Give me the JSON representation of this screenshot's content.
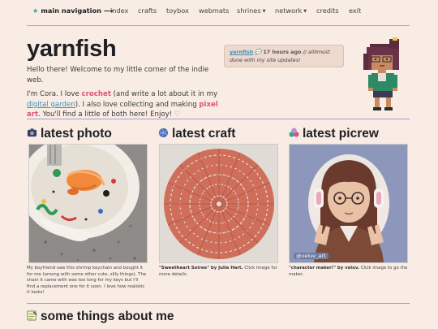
{
  "nav": {
    "home_label": "main navigation",
    "items": [
      "index",
      "crafts",
      "toybox",
      "webmats",
      "shrines",
      "network",
      "credits",
      "exit"
    ]
  },
  "header": {
    "title": "yarnfish",
    "greeting": "Hello there! Welcome to my little corner of the indie web.",
    "intro_1": "I'm Cora. I love ",
    "intro_crochet": "crochet",
    "intro_2": " (and write a lot about it in my ",
    "intro_garden": "digital garden",
    "intro_3": "). I also love collecting and making ",
    "intro_pixel": "pixel art",
    "intro_4": ". You'll find a little of both here! Enjoy! ",
    "heart": "♡"
  },
  "status": {
    "user": "yarnfish",
    "time": "17 hours ago",
    "message": "// allllmost done with my site updates!"
  },
  "sections": {
    "photo_title": "latest photo",
    "photo_caption": "My boyfriend saw this shrimp keychain and bought it for me (among with some other cute, silly things). The chain it came with was too long for my keys but I'll find a replacement one for it soon. I love how realistic it looks!",
    "craft_title": "latest craft",
    "craft_caption_bold": "\"Sweetheart Soiree\" by Julia Hart.",
    "craft_caption": " Click image for more details.",
    "picrew_title": "latest picrew",
    "picrew_caption_bold": "\"character maker!\" by veluv.",
    "picrew_caption": " Click image to go the maker.",
    "picrew_tag": "@veluv_art",
    "about_title": "some things about me"
  },
  "colors": {
    "background": "#f8ece4",
    "accent_pink": "#e0507a",
    "link_blue": "#3d8fb8",
    "rule_red": "#e88f9c",
    "rule_purple": "#b394d6",
    "rule_blue": "#72b7d6",
    "nav_star": "#3aa58c"
  },
  "icons": [
    "star-icon",
    "caret-down-icon",
    "camera-icon",
    "yarn-ball-icon",
    "paint-palette-icon",
    "memo-icon"
  ]
}
